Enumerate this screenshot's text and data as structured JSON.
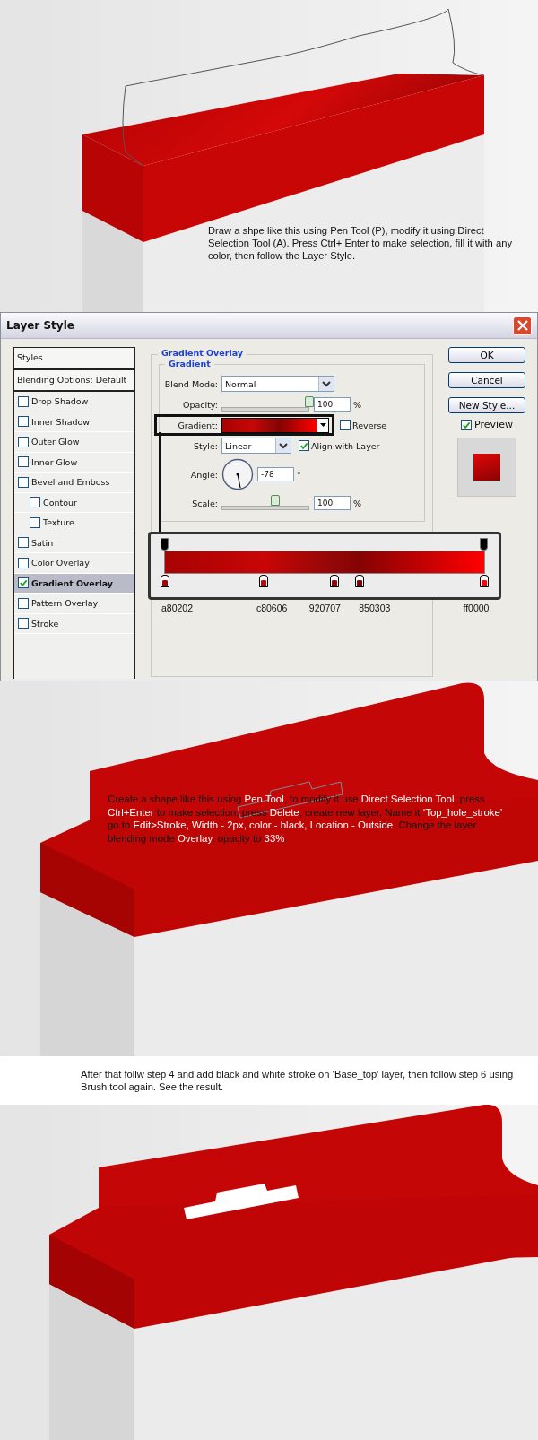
{
  "step1": {
    "instruction": "Draw a shpe like this using Pen Tool (P), modify it using Direct Selection Tool (A). Press Ctrl+ Enter to make selection, fill it with any color, then follow the Layer Style."
  },
  "dialog": {
    "title": "Layer Style",
    "styles_header": "Styles",
    "blending_options": "Blending Options: Default",
    "style_items": [
      {
        "label": "Drop Shadow",
        "checked": false,
        "selected": false
      },
      {
        "label": "Inner Shadow",
        "checked": false,
        "selected": false
      },
      {
        "label": "Outer Glow",
        "checked": false,
        "selected": false
      },
      {
        "label": "Inner Glow",
        "checked": false,
        "selected": false
      },
      {
        "label": "Bevel and Emboss",
        "checked": false,
        "selected": false,
        "children": [
          {
            "label": "Contour",
            "checked": false,
            "selected": false
          },
          {
            "label": "Texture",
            "checked": false,
            "selected": false
          }
        ]
      },
      {
        "label": "Satin",
        "checked": false,
        "selected": false
      },
      {
        "label": "Color Overlay",
        "checked": false,
        "selected": false
      },
      {
        "label": "Gradient Overlay",
        "checked": true,
        "selected": true
      },
      {
        "label": "Pattern Overlay",
        "checked": false,
        "selected": false
      },
      {
        "label": "Stroke",
        "checked": false,
        "selected": false
      }
    ],
    "panel_title": "Gradient Overlay",
    "group_title": "Gradient",
    "blend_mode": {
      "label": "Blend Mode:",
      "value": "Normal"
    },
    "opacity": {
      "label": "Opacity:",
      "level": 1,
      "value": "100",
      "unit": "%"
    },
    "gradient": {
      "label": "Gradient:"
    },
    "reverse": {
      "label": "Reverse",
      "checked": false
    },
    "style": {
      "label": "Style:",
      "value": "Linear"
    },
    "align": {
      "label": "Align with Layer",
      "checked": true
    },
    "angle": {
      "label": "Angle:",
      "value": "-78",
      "unit": "°"
    },
    "scale": {
      "label": "Scale:",
      "level": 0.6,
      "value": "100",
      "unit": "%"
    },
    "buttons": [
      "OK",
      "Cancel",
      "New Style..."
    ],
    "preview": {
      "label": "Preview",
      "checked": true
    }
  },
  "gradient_editor": {
    "opacity_stops": [
      {
        "level": 0
      },
      {
        "level": 1
      }
    ],
    "color_stops": [
      {
        "label": "a80202",
        "color": "#a80202",
        "level": 0
      },
      {
        "label": "c80606",
        "color": "#c80606",
        "level": 0.31
      },
      {
        "label": "920707",
        "color": "#920707",
        "level": 0.53
      },
      {
        "label": "850303",
        "color": "#850303",
        "level": 0.61
      },
      {
        "label": "ff0000",
        "color": "#ff0000",
        "level": 1
      }
    ]
  },
  "step2": {
    "instruction": "Create a shape like this using **Pen Tool**, to modify it use **Direct Selection Tool**, press **Ctrl+Enter** to make selection, press **Delete**, create new layer, Name it **‘Top_hole_stroke’** go to **Edit>Stroke, Width - 2px, color - black, Location - Outside**. Change the layer blending mode **Overlay**, opacity to **33%**."
  },
  "step3": {
    "instruction": "After that follw step 4 and add black and white stroke on ‘Base_top’ layer, then follow step 6 using Brush tool again. See the result."
  }
}
